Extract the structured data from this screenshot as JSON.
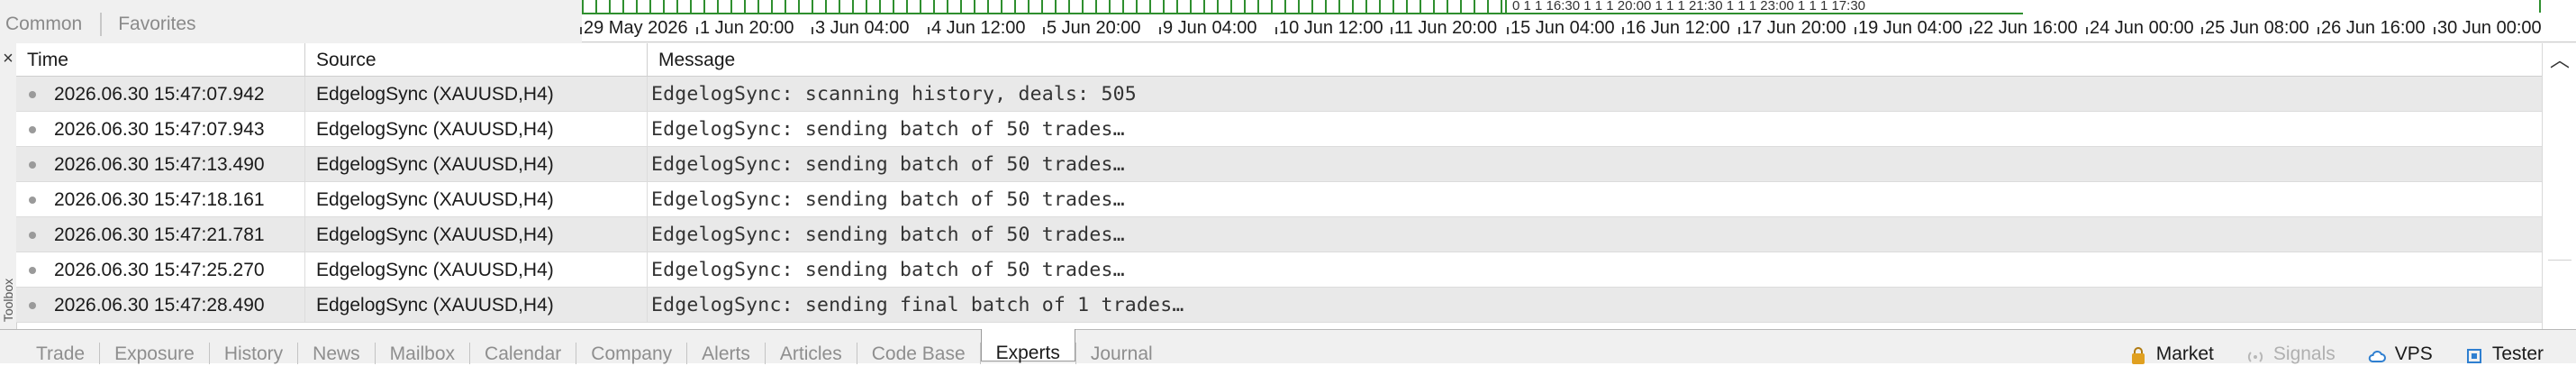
{
  "nav": {
    "tabs": [
      "Common",
      "Favorites"
    ]
  },
  "time_axis": {
    "labels": [
      "29 May 2026",
      "1 Jun 20:00",
      "3 Jun 04:00",
      "4 Jun 12:00",
      "5 Jun 20:00",
      "9 Jun 04:00",
      "10 Jun 12:00",
      "11 Jun 20:00",
      "15 Jun 04:00",
      "16 Jun 12:00",
      "17 Jun 20:00",
      "19 Jun 04:00",
      "22 Jun 16:00",
      "24 Jun 00:00",
      "25 Jun 08:00",
      "26 Jun 16:00",
      "30 Jun 00:00"
    ],
    "mini_labels": "0 1 1 16:30  1 1 1 20:00 1 1 1 21:30 1 1 1 23:00 1 1 1 17:30"
  },
  "journal": {
    "side_label": "Toolbox",
    "columns": {
      "time": "Time",
      "source": "Source",
      "message": "Message"
    },
    "rows": [
      {
        "time": "2026.06.30 15:47:07.942",
        "source": "EdgelogSync (XAUUSD,H4)",
        "message": "EdgelogSync: scanning history, deals: 505"
      },
      {
        "time": "2026.06.30 15:47:07.943",
        "source": "EdgelogSync (XAUUSD,H4)",
        "message": "EdgelogSync: sending batch of 50 trades…"
      },
      {
        "time": "2026.06.30 15:47:13.490",
        "source": "EdgelogSync (XAUUSD,H4)",
        "message": "EdgelogSync: sending batch of 50 trades…"
      },
      {
        "time": "2026.06.30 15:47:18.161",
        "source": "EdgelogSync (XAUUSD,H4)",
        "message": "EdgelogSync: sending batch of 50 trades…"
      },
      {
        "time": "2026.06.30 15:47:21.781",
        "source": "EdgelogSync (XAUUSD,H4)",
        "message": "EdgelogSync: sending batch of 50 trades…"
      },
      {
        "time": "2026.06.30 15:47:25.270",
        "source": "EdgelogSync (XAUUSD,H4)",
        "message": "EdgelogSync: sending batch of 50 trades…"
      },
      {
        "time": "2026.06.30 15:47:28.490",
        "source": "EdgelogSync (XAUUSD,H4)",
        "message": "EdgelogSync: sending final batch of 1 trades…"
      }
    ]
  },
  "bottom_tabs": [
    "Trade",
    "Exposure",
    "History",
    "News",
    "Mailbox",
    "Calendar",
    "Company",
    "Alerts",
    "Articles",
    "Code Base",
    "Experts",
    "Journal"
  ],
  "active_tab": "Experts",
  "status": {
    "market": "Market",
    "signals": "Signals",
    "vps": "VPS",
    "tester": "Tester"
  },
  "colors": {
    "accent_green": "#2f8f2f",
    "market_icon": "#e0a020",
    "vps_icon": "#2f7fd0",
    "tester_icon": "#2f7fd0"
  }
}
